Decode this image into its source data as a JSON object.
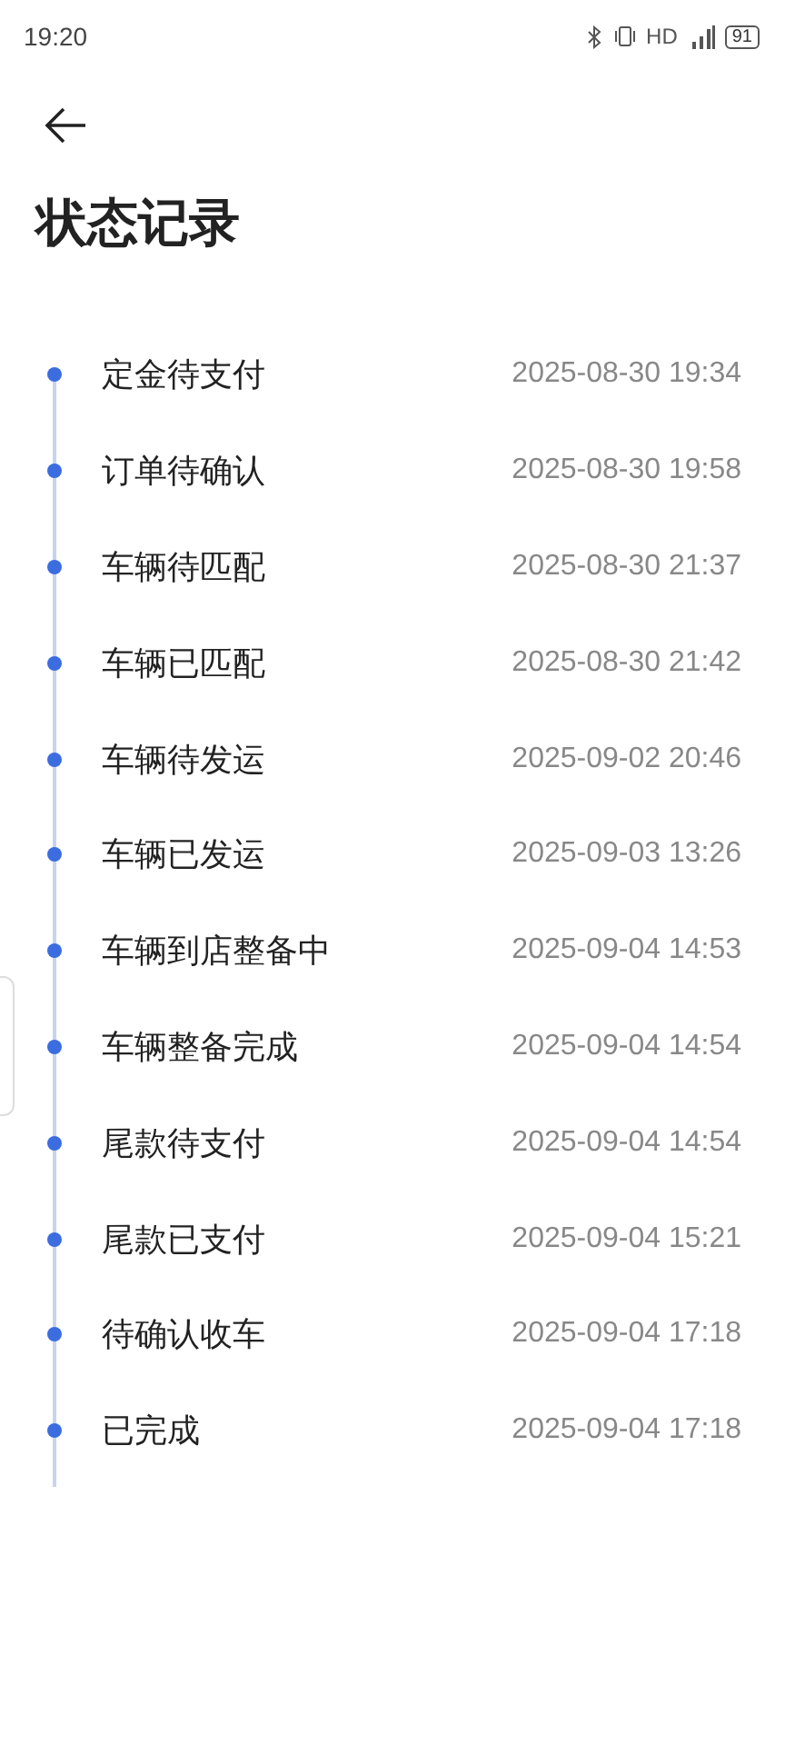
{
  "status_bar": {
    "time": "19:20",
    "network": "HD",
    "battery": "91"
  },
  "title": "状态记录",
  "records": [
    {
      "status": "定金待支付",
      "time": "2025-08-30 19:34"
    },
    {
      "status": "订单待确认",
      "time": "2025-08-30 19:58"
    },
    {
      "status": "车辆待匹配",
      "time": "2025-08-30 21:37"
    },
    {
      "status": "车辆已匹配",
      "time": "2025-08-30 21:42"
    },
    {
      "status": "车辆待发运",
      "time": "2025-09-02 20:46"
    },
    {
      "status": "车辆已发运",
      "time": "2025-09-03 13:26"
    },
    {
      "status": "车辆到店整备中",
      "time": "2025-09-04 14:53"
    },
    {
      "status": "车辆整备完成",
      "time": "2025-09-04 14:54"
    },
    {
      "status": "尾款待支付",
      "time": "2025-09-04 14:54"
    },
    {
      "status": "尾款已支付",
      "time": "2025-09-04 15:21"
    },
    {
      "status": "待确认收车",
      "time": "2025-09-04 17:18"
    },
    {
      "status": "已完成",
      "time": "2025-09-04 17:18"
    }
  ]
}
